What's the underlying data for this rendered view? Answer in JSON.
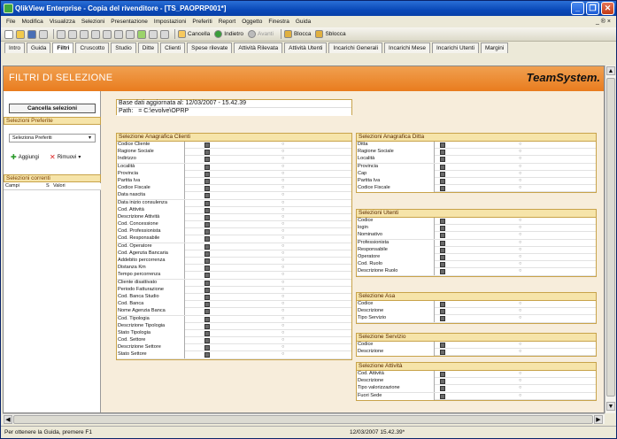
{
  "window": {
    "title": "QlikView Enterprise - Copia del rivenditore - [TS_PAOPRP001*]"
  },
  "menu": [
    "File",
    "Modifica",
    "Visualizza",
    "Selezioni",
    "Presentazione",
    "Impostazioni",
    "Preferiti",
    "Report",
    "Oggetto",
    "Finestra",
    "Guida"
  ],
  "menu_right": "_ ® ×",
  "toolbar": {
    "cancella": "Cancella",
    "indietro": "Indietro",
    "avanti": "Avanti",
    "blocca": "Blocca",
    "sblocca": "Sblocca"
  },
  "tabs": [
    "Intro",
    "Guida",
    "Filtri",
    "Cruscotto",
    "Studio",
    "Ditte",
    "Clienti",
    "Spese rilevate",
    "Attività Rilevata",
    "Attività Utenti",
    "Incarichi Generali",
    "Incarichi Mese",
    "Incarichi Utenti",
    "Margini"
  ],
  "active_tab": "Filtri",
  "header": {
    "title": "FILTRI DI SELEZIONE",
    "brand": "TeamSystem."
  },
  "left": {
    "clear_button": "Cancella selezioni",
    "preferite_title": "Selezioni Preferite",
    "select_placeholder": "Seleziona Preferiti",
    "add": "Aggiungi",
    "remove": "Rimuovi",
    "current_title": "Selezioni correnti",
    "col_campi": "Campi",
    "col_s": "S",
    "col_valori": "Valori"
  },
  "info": {
    "base": "Base dati aggiornata al: 12/03/2007 - 15.42.39",
    "path_label": "Path:",
    "path_value": "= C:\\evolve\\OPRP"
  },
  "groups": [
    {
      "title": "Selezione Anagrafica Clienti",
      "rows": [
        "Codice Cliente",
        "Ragione Sociale",
        "Indirizzo",
        "Località",
        "Provincia",
        "Partita Iva",
        "Codice Fiscale",
        "Data nascita",
        "Data inizio consulenza",
        "Cod. Attività",
        "Descrizione Attività",
        "Cod. Concessione",
        "Cod. Professionista",
        "Cod. Responsabile",
        "Cod. Operatore",
        "Cod. Agenzia Bancaria",
        "Addebito percorrenza",
        "Distanza Km",
        "Tempo percorrenza",
        "Cliente disattivato",
        "Periodo Fatturazione",
        "Cod. Banca Studio",
        "Cod. Banca",
        "Nome Agenzia Banca",
        "Cod. Tipologia",
        "Descrizione Tipologia",
        "Stato Tipologia",
        "Cod. Settore",
        "Descrizione Settore",
        "Stato Settore"
      ]
    },
    {
      "title": "Selezioni Anagrafica Ditta",
      "rows": [
        "Ditta",
        "Ragione Sociale",
        "Località",
        "Provincia",
        "Cap",
        "Partita Iva",
        "Codice Fiscale"
      ]
    },
    {
      "title": "Selezioni Utenti",
      "rows": [
        "Codice",
        "login",
        "Nominativo",
        "Professionista",
        "Responsabile",
        "Operatore",
        "Cod. Ruolo",
        "Descrizione Ruolo"
      ]
    },
    {
      "title": "Selezione Asa",
      "rows": [
        "Codice",
        "Descrizione",
        "Tipo Servizio"
      ]
    },
    {
      "title": "Selezione Servizio",
      "rows": [
        "Codice",
        "Descrizione"
      ]
    },
    {
      "title": "Selezione Attività",
      "rows": [
        "Cod. Attività",
        "Descrizione",
        "Tipo valorizzazione",
        "Fuori Sede"
      ]
    }
  ],
  "status": {
    "help": "Per ottenere la Guida, premere F1",
    "timestamp": "12/03/2007 15.42.39*"
  }
}
